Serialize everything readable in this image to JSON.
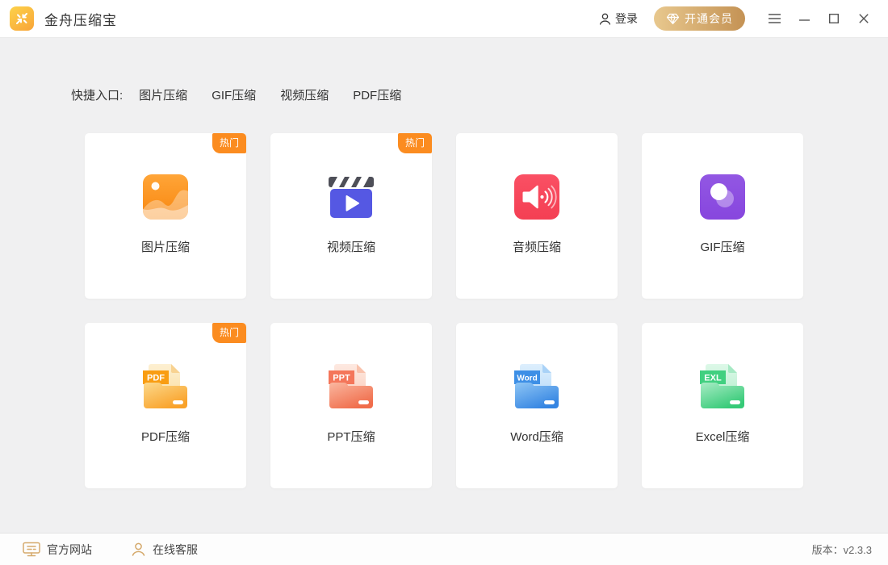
{
  "header": {
    "app_title": "金舟压缩宝",
    "login_label": "登录",
    "vip_label": "开通会员",
    "vip_gradient": {
      "from": "#e8c88e",
      "to": "#c49254"
    }
  },
  "quick_entry": {
    "label": "快捷入口:",
    "links": [
      "图片压缩",
      "GIF压缩",
      "视频压缩",
      "PDF压缩"
    ]
  },
  "hot_badge_label": "热门",
  "accent_color": "#fb8c20",
  "cards": [
    {
      "label": "图片压缩",
      "icon": "image-icon",
      "hot": true,
      "color": "#f98c14"
    },
    {
      "label": "视频压缩",
      "icon": "video-icon",
      "hot": true,
      "color": "#5558e3"
    },
    {
      "label": "音频压缩",
      "icon": "audio-icon",
      "hot": false,
      "color": "#f8475c"
    },
    {
      "label": "GIF压缩",
      "icon": "gif-icon",
      "hot": false,
      "color": "#8d4ce0"
    },
    {
      "label": "PDF压缩",
      "icon": "pdf-folder-icon",
      "hot": true,
      "badge": "PDF",
      "color": "#f9a01e"
    },
    {
      "label": "PPT压缩",
      "icon": "ppt-folder-icon",
      "hot": false,
      "badge": "PPT",
      "color": "#f4765a"
    },
    {
      "label": "Word压缩",
      "icon": "word-folder-icon",
      "hot": false,
      "badge": "Word",
      "color": "#3d8fe6"
    },
    {
      "label": "Excel压缩",
      "icon": "excel-folder-icon",
      "hot": false,
      "badge": "EXL",
      "color": "#41d080"
    }
  ],
  "footer": {
    "website_label": "官方网站",
    "support_label": "在线客服",
    "version_label": "版本：v2.3.3"
  }
}
